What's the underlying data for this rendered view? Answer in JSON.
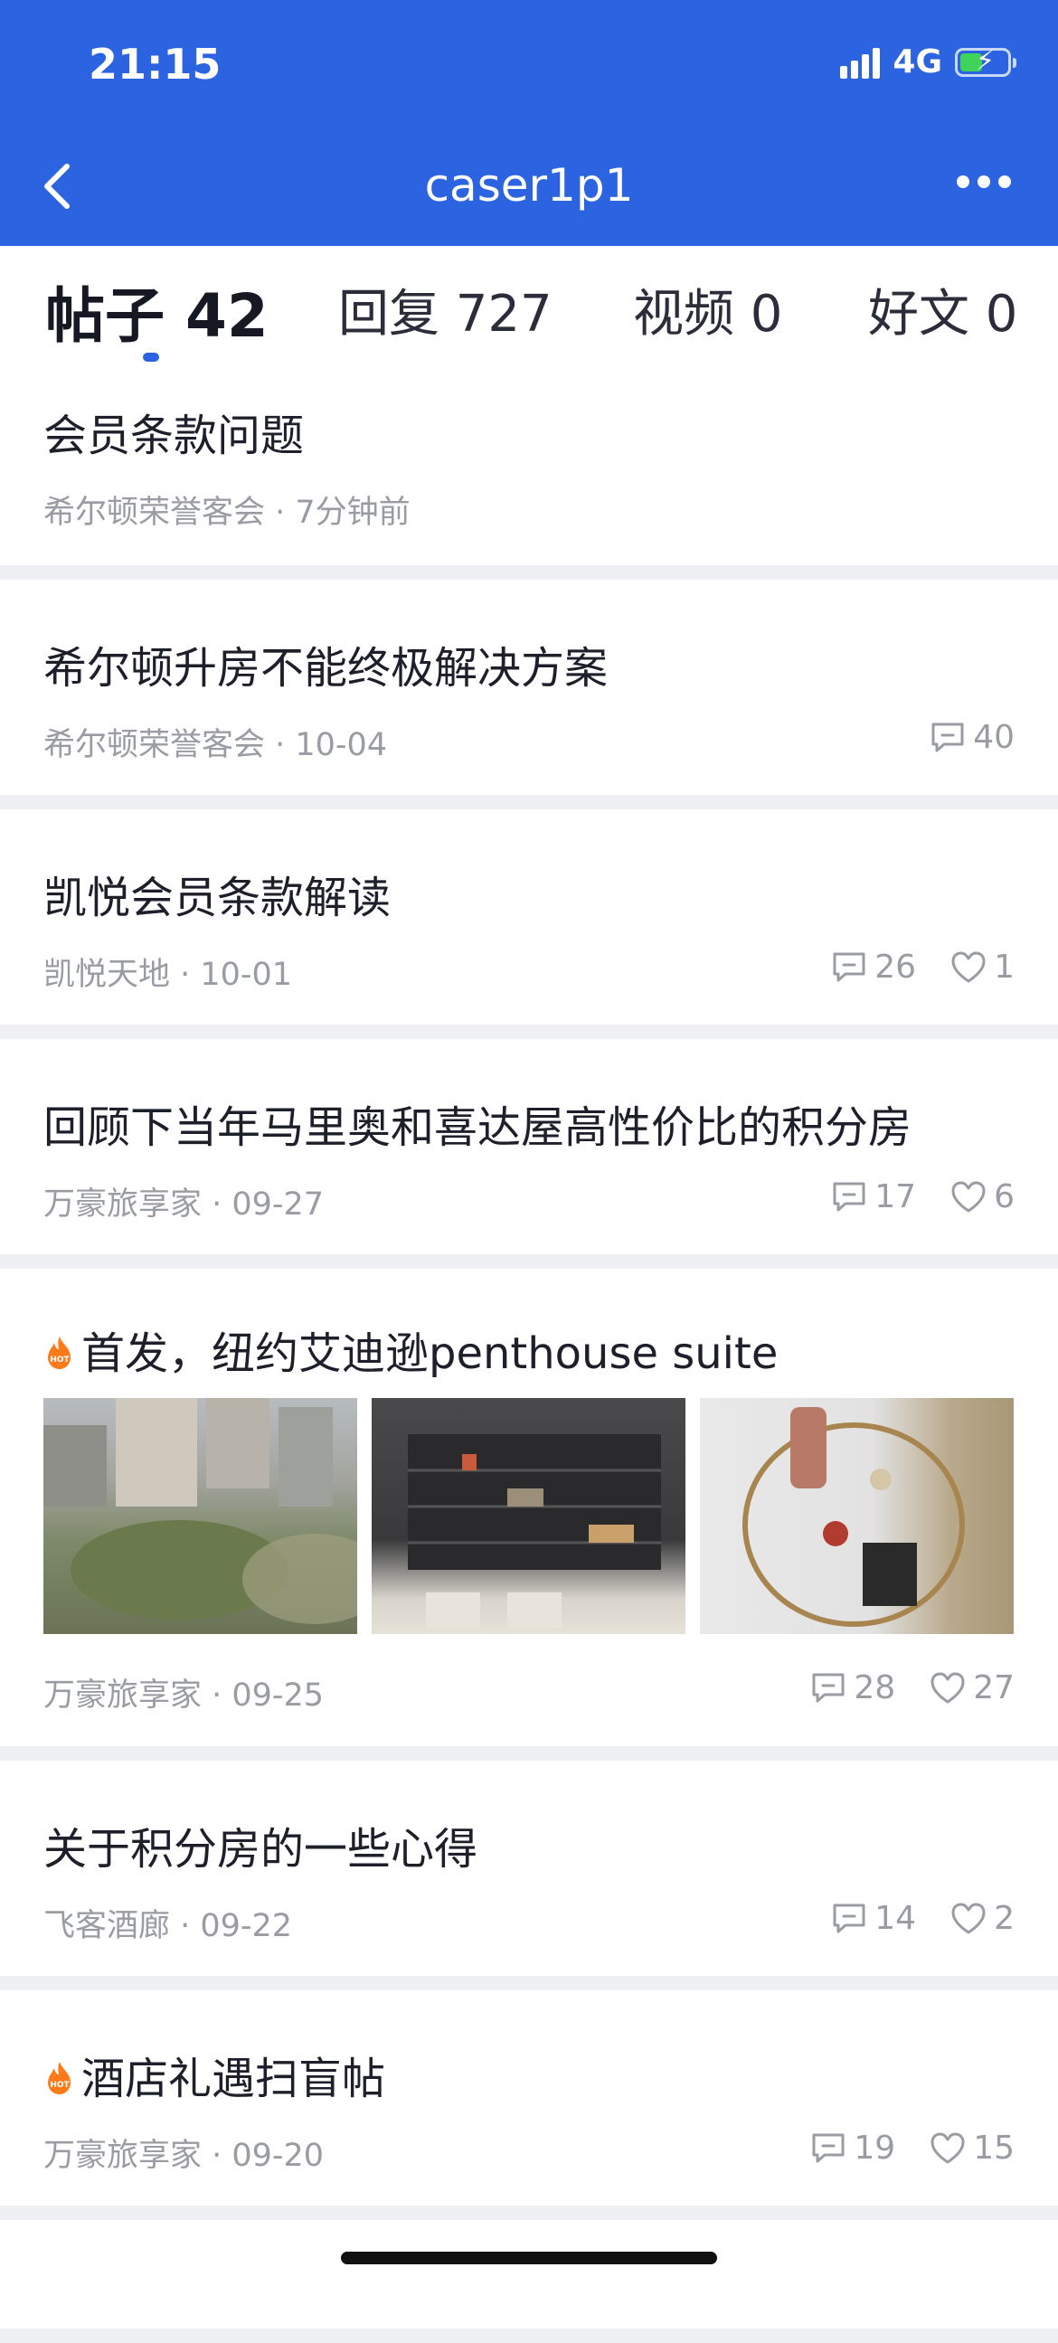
{
  "status": {
    "time": "21:15",
    "network": "4G"
  },
  "nav": {
    "title": "caser1p1"
  },
  "tabs": [
    {
      "label": "帖子 42"
    },
    {
      "label": "回复 727"
    },
    {
      "label": "视频 0"
    },
    {
      "label": "好文 0"
    }
  ],
  "posts": [
    {
      "title": "会员条款问题",
      "meta": "希尔顿荣誉客会 · 7分钟前"
    },
    {
      "title": "希尔顿升房不能终极解决方案",
      "meta": "希尔顿荣誉客会 · 10-04",
      "comments": "40"
    },
    {
      "title": "凯悦会员条款解读",
      "meta": "凯悦天地 · 10-01",
      "comments": "26",
      "likes": "1"
    },
    {
      "title": "回顾下当年马里奥和喜达屋高性价比的积分房",
      "meta": "万豪旅享家 · 09-27",
      "comments": "17",
      "likes": "6"
    },
    {
      "title": "首发，纽约艾迪逊penthouse suite",
      "meta": "万豪旅享家 · 09-25",
      "comments": "28",
      "likes": "27",
      "hot_badge": "HOT"
    },
    {
      "title": "关于积分房的一些心得",
      "meta": "飞客酒廊 · 09-22",
      "comments": "14",
      "likes": "2"
    },
    {
      "title": "酒店礼遇扫盲帖",
      "meta": "万豪旅享家 · 09-20",
      "comments": "19",
      "likes": "15",
      "hot_badge": "HOT"
    }
  ],
  "colors": {
    "header_bg": "#2b63e0",
    "accent": "#2b63e0",
    "hot": "#ff7a1a"
  }
}
